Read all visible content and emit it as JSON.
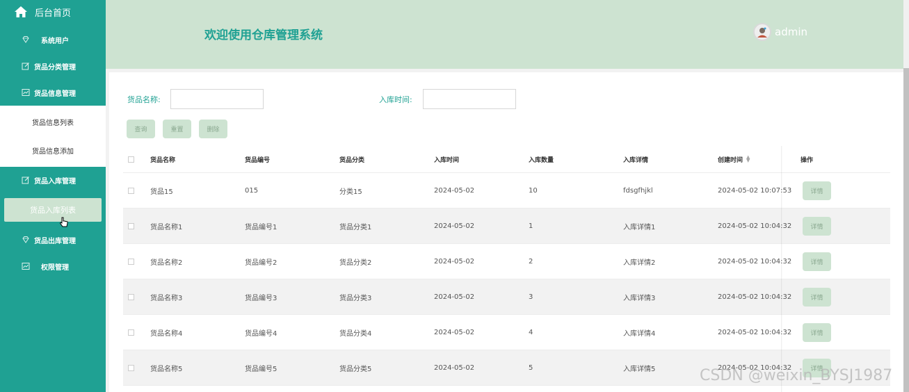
{
  "sidebar": {
    "home": {
      "label": "后台首页",
      "icon": "home-icon"
    },
    "items": [
      {
        "label": "系统用户",
        "icon": "diamond-icon"
      },
      {
        "label": "货品分类管理",
        "icon": "edit-icon"
      },
      {
        "label": "货品信息管理",
        "icon": "chart-icon"
      },
      {
        "label": "货品入库管理",
        "icon": "edit-icon"
      },
      {
        "label": "货品出库管理",
        "icon": "diamond-icon"
      },
      {
        "label": "权限管理",
        "icon": "chart-icon"
      }
    ],
    "info_submenu": [
      "货品信息列表",
      "货品信息添加"
    ],
    "inbound_submenu": [
      "货品入库列表"
    ]
  },
  "header": {
    "title": "欢迎使用仓库管理系统",
    "username": "admin"
  },
  "search": {
    "name_label": "货品名称:",
    "time_label": "入库时间:",
    "name_value": "",
    "time_value": ""
  },
  "buttons": {
    "query": "查询",
    "reset": "重置",
    "delete": "删除"
  },
  "table": {
    "headers": [
      "货品名称",
      "货品编号",
      "货品分类",
      "入库时间",
      "入库数量",
      "入库详情",
      "创建时间",
      "操作"
    ],
    "detail_label": "详情",
    "rows": [
      [
        "货品15",
        "015",
        "分类15",
        "2024-05-02",
        "10",
        "fdsgfhjkl",
        "2024-05-02 10:07:53"
      ],
      [
        "货品名称1",
        "货品编号1",
        "货品分类1",
        "2024-05-02",
        "1",
        "入库详情1",
        "2024-05-02 10:04:32"
      ],
      [
        "货品名称2",
        "货品编号2",
        "货品分类2",
        "2024-05-02",
        "2",
        "入库详情2",
        "2024-05-02 10:04:32"
      ],
      [
        "货品名称3",
        "货品编号3",
        "货品分类3",
        "2024-05-02",
        "3",
        "入库详情3",
        "2024-05-02 10:04:32"
      ],
      [
        "货品名称4",
        "货品编号4",
        "货品分类4",
        "2024-05-02",
        "4",
        "入库详情4",
        "2024-05-02 10:04:32"
      ],
      [
        "货品名称5",
        "货品编号5",
        "货品分类5",
        "2024-05-02",
        "5",
        "入库详情5",
        "2024-05-02 10:04:32"
      ]
    ]
  },
  "watermark": "CSDN @weixin_BYSJ1987",
  "colors": {
    "sidebar": "#1fa193",
    "header": "#cde3d1",
    "accent": "#1fa193",
    "button": "#cde3d1"
  }
}
